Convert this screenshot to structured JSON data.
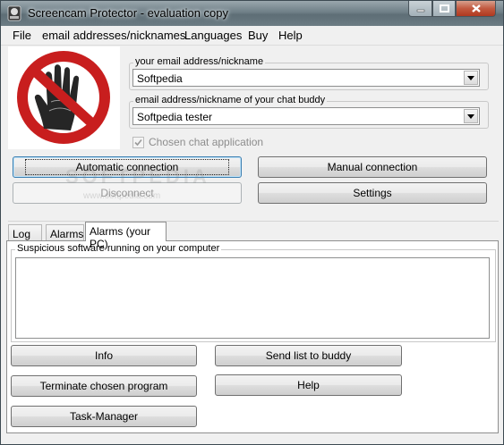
{
  "window": {
    "title": "Screencam Protector - evaluation copy",
    "colors": {
      "titlebar": "#6f7f87",
      "close_button": "#c25a40",
      "stop_sign_red": "#c81e1e"
    }
  },
  "menu": [
    "File",
    "email addresses/nicknames",
    "Languages",
    "Buy",
    "Help"
  ],
  "form": {
    "email_label": "your email address/nickname",
    "email_value": "Softpedia",
    "buddy_label": "email address/nickname of your chat buddy",
    "buddy_value": "Softpedia tester",
    "chosen_chat_label": "Chosen chat application",
    "chosen_chat_checked": true
  },
  "buttons": {
    "automatic": "Automatic connection",
    "manual": "Manual connection",
    "disconnect": "Disconnect",
    "settings": "Settings",
    "info": "Info",
    "send_list": "Send list to buddy",
    "terminate": "Terminate chosen program",
    "help": "Help",
    "task_manager": "Task-Manager"
  },
  "tabs": [
    "Log",
    "Alarms",
    "Alarms (your PC)"
  ],
  "active_tab": "Alarms (your PC)",
  "panel": {
    "group_label": "Suspicious software running on your computer",
    "items": []
  },
  "watermark": {
    "text": "SOFTPEDIA",
    "subtext": "www.softpedia.com"
  }
}
